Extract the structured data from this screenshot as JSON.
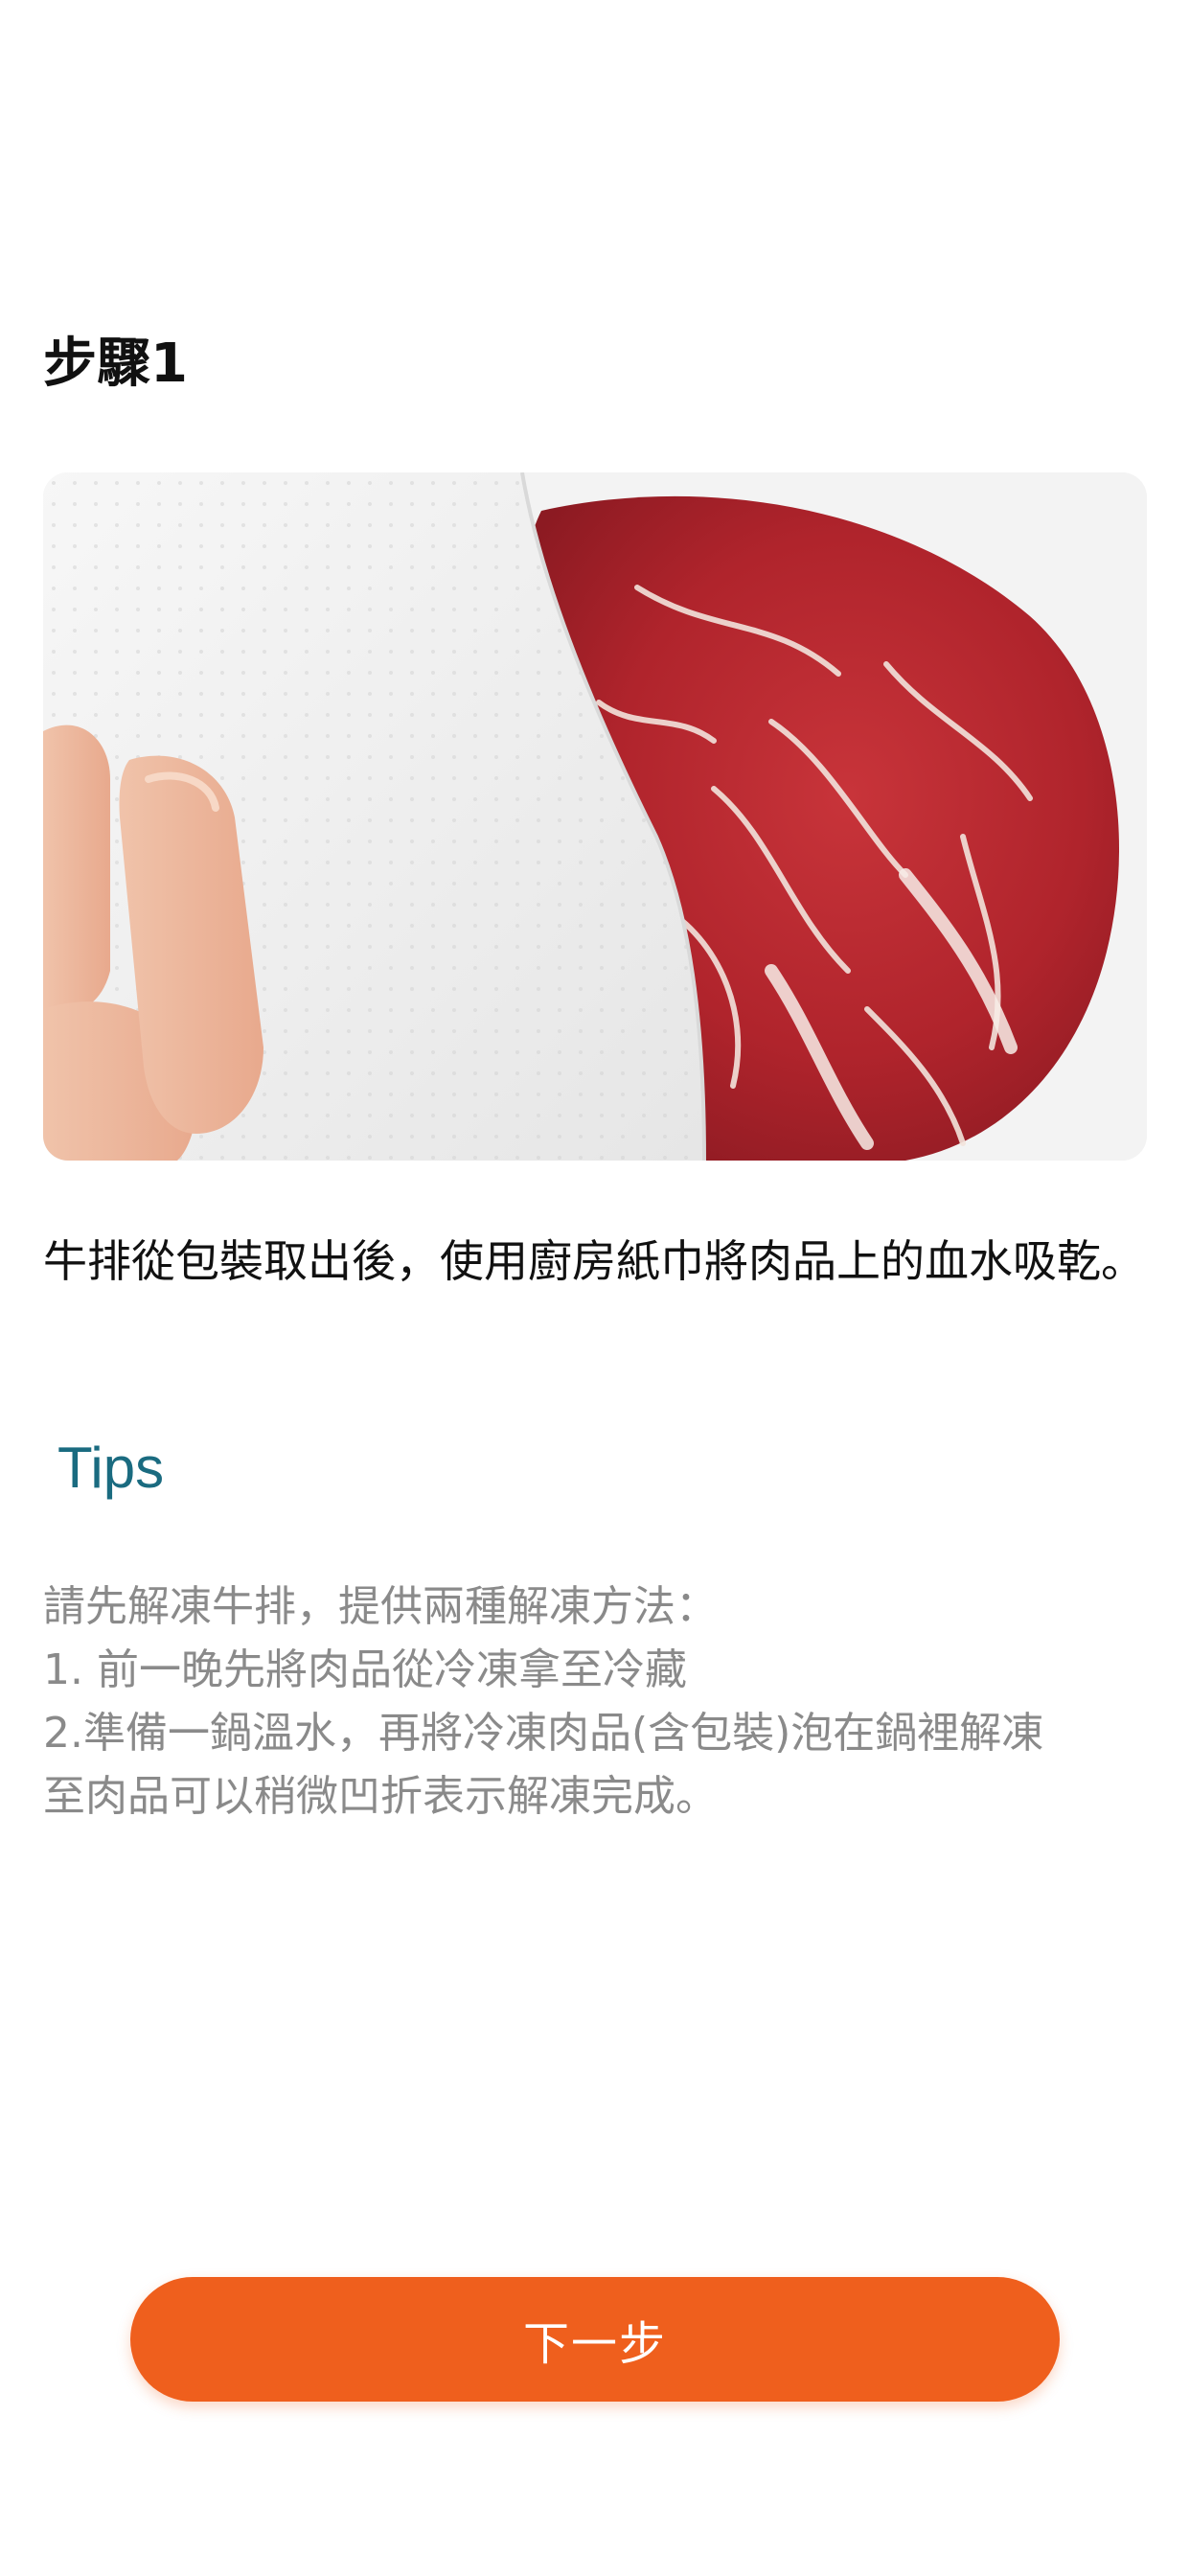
{
  "step": {
    "title": "步驟1",
    "description": "牛排從包裝取出後，使用廚房紙巾將肉品上的血水吸乾。"
  },
  "photo": {
    "subject": "steak-with-paper-towel-photo"
  },
  "tips": {
    "heading": "Tips",
    "lines": [
      "請先解凍牛排，提供兩種解凍方法：",
      "1. 前一晚先將肉品從冷凍拿至冷藏",
      "2.準備一鍋溫水，再將冷凍肉品(含包裝)泡在鍋裡解凍",
      "至肉品可以稍微凹折表示解凍完成。"
    ]
  },
  "actions": {
    "next_label": "下一步"
  },
  "colors": {
    "accent": "#ef5f1d",
    "tips_heading": "#1a6b80",
    "tips_text": "#8a8a8a"
  }
}
